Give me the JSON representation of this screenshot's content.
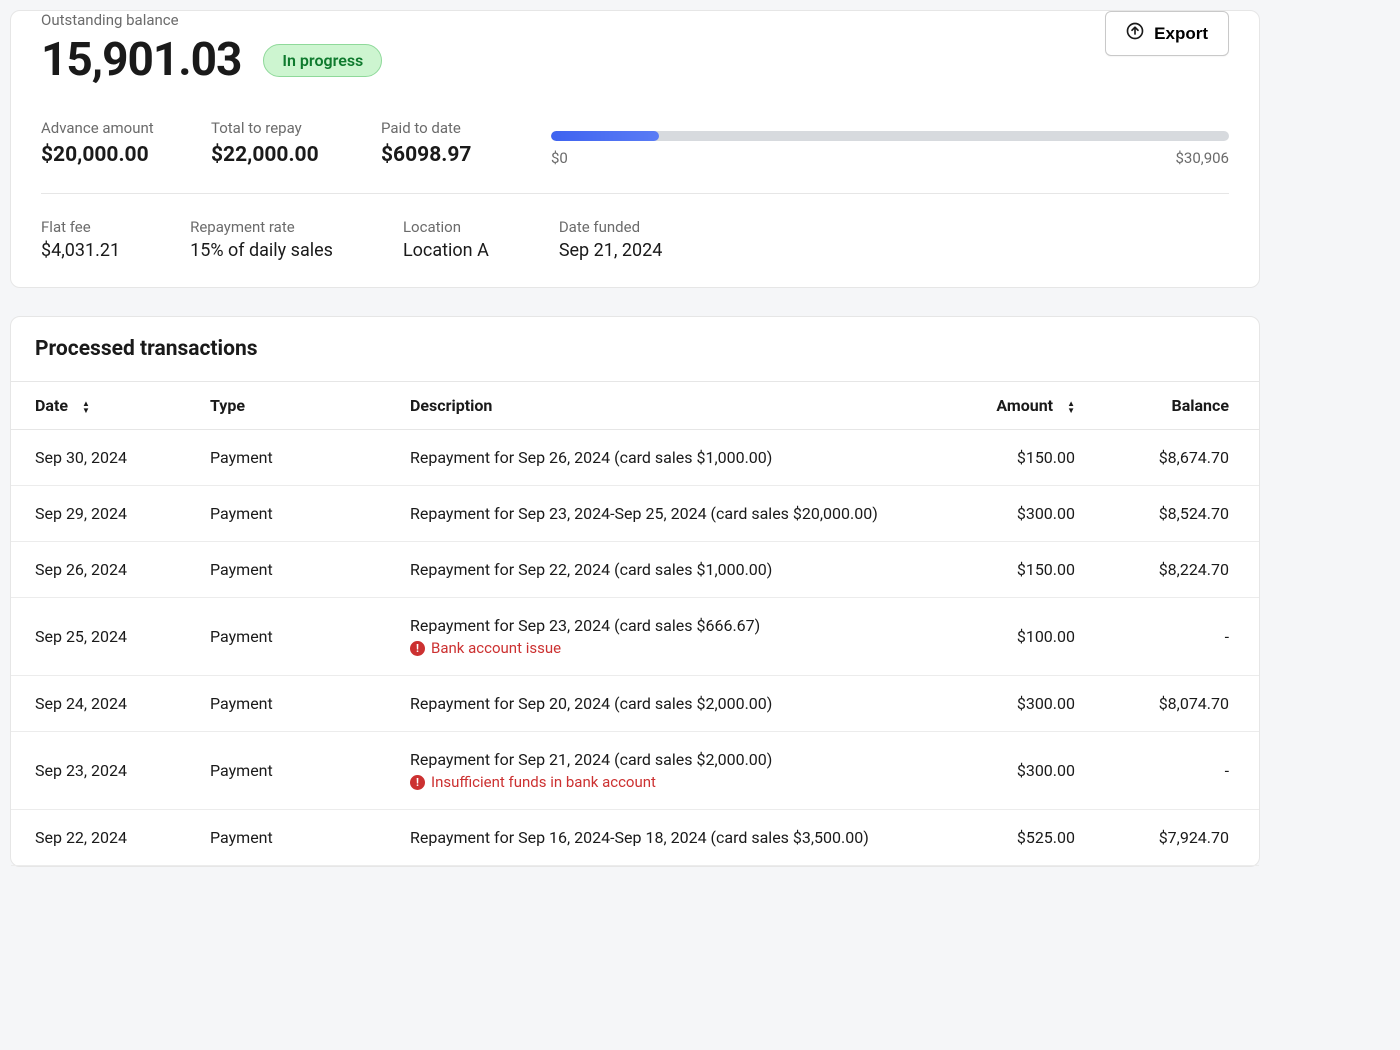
{
  "balance": {
    "label": "Outstanding balance",
    "value": "15,901.03",
    "status": "In progress"
  },
  "export_label": "Export",
  "financials": {
    "advance": {
      "label": "Advance amount",
      "value": "$20,000.00"
    },
    "total_repay": {
      "label": "Total to repay",
      "value": "$22,000.00"
    },
    "paid_to_date": {
      "label": "Paid to date",
      "value": "$6098.97"
    },
    "progress": {
      "min_label": "$0",
      "max_label": "$30,906",
      "percent": 16
    }
  },
  "meta": {
    "flat_fee": {
      "label": "Flat fee",
      "value": "$4,031.21"
    },
    "repayment_rate": {
      "label": "Repayment rate",
      "value": "15% of daily sales"
    },
    "location": {
      "label": "Location",
      "value": "Location A"
    },
    "date_funded": {
      "label": "Date funded",
      "value": "Sep 21, 2024"
    }
  },
  "transactions": {
    "title": "Processed transactions",
    "headers": {
      "date": "Date",
      "type": "Type",
      "description": "Description",
      "amount": "Amount",
      "balance": "Balance"
    },
    "rows": [
      {
        "date": "Sep 30, 2024",
        "type": "Payment",
        "description": "Repayment for Sep 26, 2024 (card sales $1,000.00)",
        "amount": "$150.00",
        "balance": "$8,674.70",
        "error": null
      },
      {
        "date": "Sep 29, 2024",
        "type": "Payment",
        "description": "Repayment for Sep 23, 2024-Sep 25, 2024 (card sales $20,000.00)",
        "amount": "$300.00",
        "balance": "$8,524.70",
        "error": null
      },
      {
        "date": "Sep 26, 2024",
        "type": "Payment",
        "description": "Repayment for Sep 22, 2024 (card sales $1,000.00)",
        "amount": "$150.00",
        "balance": "$8,224.70",
        "error": null
      },
      {
        "date": "Sep 25, 2024",
        "type": "Payment",
        "description": "Repayment for Sep 23, 2024 (card sales $666.67)",
        "amount": "$100.00",
        "balance": "-",
        "error": "Bank account issue"
      },
      {
        "date": "Sep 24, 2024",
        "type": "Payment",
        "description": "Repayment for Sep 20, 2024 (card sales $2,000.00)",
        "amount": "$300.00",
        "balance": "$8,074.70",
        "error": null
      },
      {
        "date": "Sep 23, 2024",
        "type": "Payment",
        "description": "Repayment for Sep 21, 2024 (card sales $2,000.00)",
        "amount": "$300.00",
        "balance": "-",
        "error": "Insufficient funds in bank account"
      },
      {
        "date": "Sep 22, 2024",
        "type": "Payment",
        "description": "Repayment for Sep 16, 2024-Sep 18, 2024 (card sales $3,500.00)",
        "amount": "$525.00",
        "balance": "$7,924.70",
        "error": null
      }
    ]
  }
}
